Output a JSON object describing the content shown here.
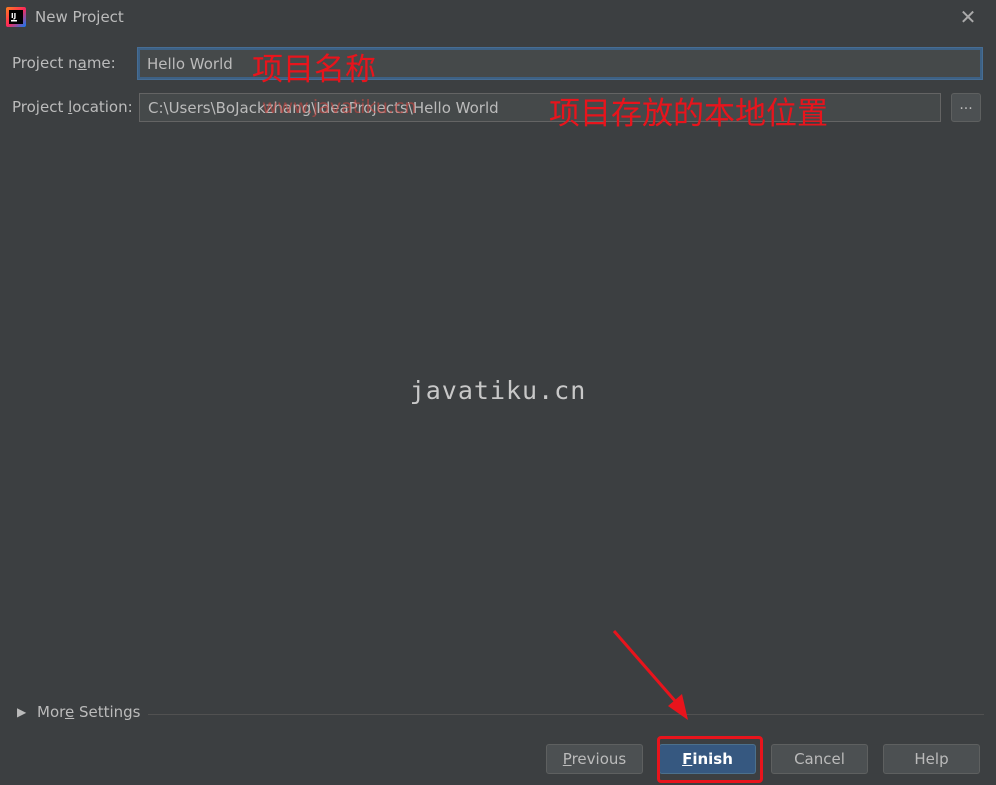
{
  "window": {
    "title": "New Project",
    "close_glyph": "✕",
    "app_icon_text": "IJ"
  },
  "form": {
    "name_label_pre": "Project n",
    "name_label_u": "a",
    "name_label_post": "me:",
    "name_value": "Hello World",
    "location_label_pre": "Project ",
    "location_label_u": "l",
    "location_label_post": "ocation:",
    "location_value": "C:\\Users\\BoJackzhang\\IdeaProjects\\Hello World",
    "browse_label": "..."
  },
  "annotations": {
    "name_note": "项目名称",
    "location_note": "项目存放的本地位置",
    "ghost_note": "www.javatiku.cn"
  },
  "watermark": "javatiku.cn",
  "more_settings": {
    "pre": "Mor",
    "u": "e",
    "post": " Settings"
  },
  "buttons": {
    "previous_u": "P",
    "previous_rest": "revious",
    "finish_u": "F",
    "finish_rest": "inish",
    "cancel": "Cancel",
    "help": "Help"
  },
  "colors": {
    "annotation_red": "#e8141c",
    "primary_button": "#365880",
    "background": "#3c3f41"
  }
}
